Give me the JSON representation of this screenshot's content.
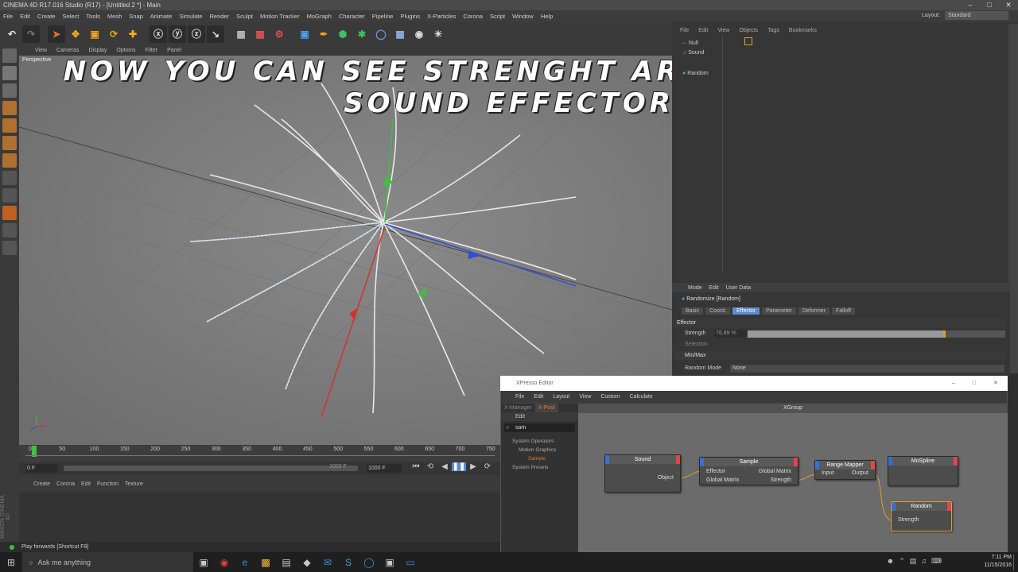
{
  "title": "CINEMA 4D R17.016 Studio (R17) - [Untitled 2 *] - Main",
  "menu": [
    "File",
    "Edit",
    "Create",
    "Select",
    "Tools",
    "Mesh",
    "Snap",
    "Animate",
    "Simulate",
    "Render",
    "Sculpt",
    "Motion Tracker",
    "MoGraph",
    "Character",
    "Pipeline",
    "Plugins",
    "X-Particles",
    "Corona",
    "Script",
    "Window",
    "Help"
  ],
  "layout_label": "Layout:",
  "layout_value": "Standard",
  "viewport_menu": [
    "View",
    "Cameras",
    "Display",
    "Options",
    "Filter",
    "Panel"
  ],
  "viewport_name": "Perspective",
  "overlay_line1": "Now you can see strenght are working by",
  "overlay_line2": "Sound effector",
  "timeline_ticks": [
    "0",
    "50",
    "100",
    "150",
    "200",
    "250",
    "300",
    "350",
    "400",
    "450",
    "500",
    "550",
    "600",
    "650",
    "700",
    "750"
  ],
  "current_frame": "0 F",
  "end_frame_a": "1000 F",
  "end_frame_b": "1000 F",
  "material_menu": [
    "Create",
    "Corona",
    "Edit",
    "Function",
    "Texture"
  ],
  "status_text": "Play forwards [Shortcut F8]",
  "object_manager": {
    "menu": [
      "File",
      "Edit",
      "View",
      "Objects",
      "Tags",
      "Bookmarks"
    ],
    "objects": [
      "Null",
      "Sound",
      "",
      "Random"
    ]
  },
  "attributes": {
    "menu": [
      "Mode",
      "Edit",
      "User Data"
    ],
    "object_title": "Randomize [Random]",
    "tabs": [
      "Basic",
      "Coord.",
      "Effector",
      "Parameter",
      "Deformer",
      "Falloff"
    ],
    "active_tab": "Effector",
    "section": "Effector",
    "strength_label": "Strength",
    "strength_value": "76.89 %",
    "strength_fraction": 0.77,
    "selection_label": "Selection",
    "minmax_label": "Min/Max",
    "random_mode_label": "Random Mode",
    "random_mode_value": "None"
  },
  "xpresso": {
    "title": "XPresso Editor",
    "menu": [
      "File",
      "Edit",
      "Layout",
      "View",
      "Custom",
      "Calculate"
    ],
    "left_tabs": [
      "X-Manager",
      "X-Pool"
    ],
    "edit_label": "Edit",
    "search_value": "sam",
    "tree": [
      "System Operators",
      "Motion Graphics",
      "Sample",
      "System Presets"
    ],
    "group_title": "XGroup",
    "nodes": {
      "sound": {
        "title": "Sound",
        "ports": [
          "Object"
        ]
      },
      "sample": {
        "title": "Sample",
        "in": [
          "Effector",
          "Global Matrix"
        ],
        "out": [
          "Global Matrix",
          "Strength"
        ]
      },
      "range": {
        "title": "Range Mapper",
        "in": [
          "Input"
        ],
        "out": [
          "Output"
        ]
      },
      "mospline": {
        "title": "MoSpline"
      },
      "random": {
        "title": "Random",
        "in": [
          "Strength"
        ]
      }
    }
  },
  "taskbar": {
    "search_placeholder": "Ask me anything",
    "time": "7:11 PM",
    "date": "11/15/2016"
  }
}
